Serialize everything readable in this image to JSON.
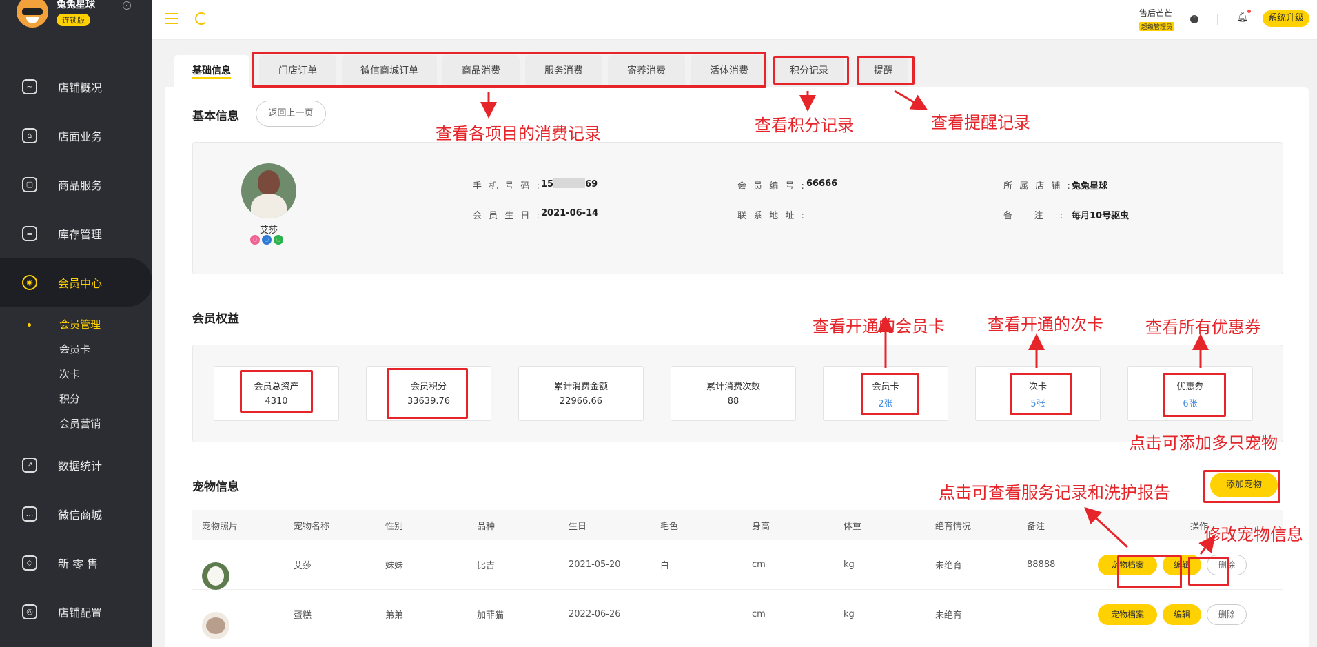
{
  "brand": {
    "store_name": "兔兔星球",
    "badge": "连锁版"
  },
  "sidebar": {
    "items": [
      {
        "label": "店铺概况",
        "icon": "dashboard-icon"
      },
      {
        "label": "店面业务",
        "icon": "store-icon"
      },
      {
        "label": "商品服务",
        "icon": "bag-icon"
      },
      {
        "label": "库存管理",
        "icon": "inventory-icon"
      },
      {
        "label": "会员中心",
        "icon": "member-icon",
        "active": true
      },
      {
        "label": "数据统计",
        "icon": "chart-icon"
      },
      {
        "label": "微信商城",
        "icon": "wechat-icon"
      },
      {
        "label": "新 零 售",
        "icon": "box-icon"
      },
      {
        "label": "店铺配置",
        "icon": "settings-icon"
      }
    ],
    "sub_items": [
      "会员管理",
      "会员卡",
      "次卡",
      "积分",
      "会员营销"
    ]
  },
  "topbar": {
    "user_name": "售后芒芒",
    "user_role": "超级管理员",
    "upgrade_label": "系统升级"
  },
  "tabs": [
    "基础信息",
    "门店订单",
    "微信商城订单",
    "商品消费",
    "服务消费",
    "寄养消费",
    "活体消费",
    "积分记录",
    "提醒"
  ],
  "basic": {
    "title": "基本信息",
    "back_label": "返回上一页",
    "member_name": "艾莎",
    "fields": {
      "phone_label": "手 机 号 码 :",
      "phone_prefix": "15",
      "phone_suffix": "69",
      "id_label": "会 员 编 号 :",
      "id_value": "66666",
      "store_label": "所 属 店 铺 :",
      "store_value": "兔兔星球",
      "birthday_label": "会 员 生 日 :",
      "birthday_value": "2021-06-14",
      "address_label": "联 系 地 址 :",
      "address_value": "",
      "note_label": "备    注   :",
      "note_value": "每月10号驱虫"
    }
  },
  "benefits": {
    "title": "会员权益",
    "cards": [
      {
        "label": "会员总资产",
        "value": "4310"
      },
      {
        "label": "会员积分",
        "value": "33639.76"
      },
      {
        "label": "累计消费金额",
        "value": "22966.66"
      },
      {
        "label": "累计消费次数",
        "value": "88"
      },
      {
        "label": "会员卡",
        "value": "2张"
      },
      {
        "label": "次卡",
        "value": "5张"
      },
      {
        "label": "优惠券",
        "value": "6张"
      }
    ]
  },
  "pets": {
    "title": "宠物信息",
    "add_label": "添加宠物",
    "columns": [
      "宠物照片",
      "宠物名称",
      "性别",
      "品种",
      "生日",
      "毛色",
      "身高",
      "体重",
      "绝育情况",
      "备注",
      "操作"
    ],
    "rows": [
      {
        "name": "艾莎",
        "gender": "妹妹",
        "breed": "比吉",
        "birthday": "2021-05-20",
        "color": "白",
        "height": "cm",
        "weight": "kg",
        "neutered": "未绝育",
        "note": "88888"
      },
      {
        "name": "蛋糕",
        "gender": "弟弟",
        "breed": "加菲猫",
        "birthday": "2022-06-26",
        "color": "",
        "height": "cm",
        "weight": "kg",
        "neutered": "未绝育",
        "note": ""
      }
    ],
    "actions": {
      "archive": "宠物档案",
      "edit": "编辑",
      "delete": "删除"
    }
  },
  "annotations": {
    "consume_records": "查看各项目的消费记录",
    "points_records": "查看积分记录",
    "reminder_records": "查看提醒记录",
    "member_cards": "查看开通的会员卡",
    "times_cards": "查看开通的次卡",
    "coupons": "查看所有优惠券",
    "add_pets": "点击可添加多只宠物",
    "pet_archive": "点击可查看服务记录和洗护报告",
    "edit_pet": "修改宠物信息"
  },
  "colors": {
    "accent": "#ffd100",
    "sidebar_bg": "#2b2d33",
    "annotation_red": "#e5252a",
    "link_blue": "#4a90e2"
  }
}
